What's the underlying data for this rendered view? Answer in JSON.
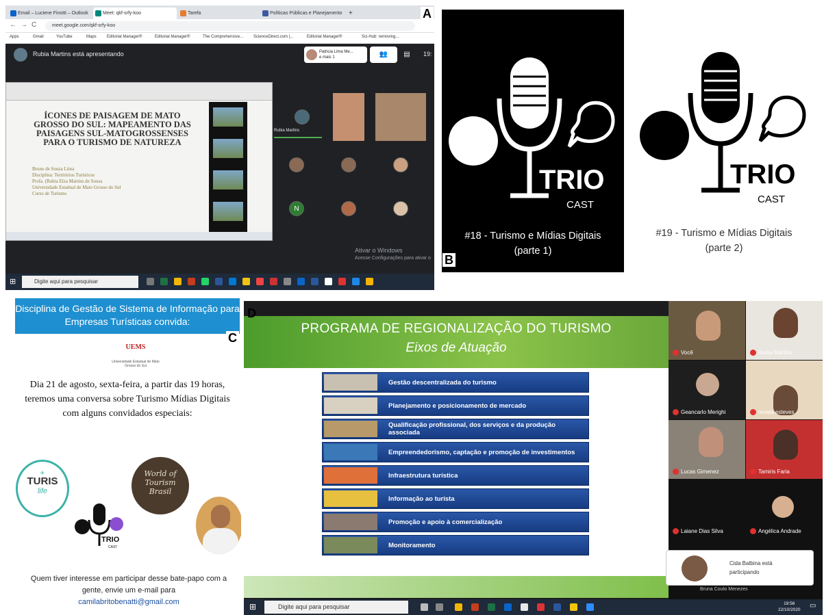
{
  "labels": {
    "a": "A",
    "b": "B",
    "c": "C",
    "d": "D"
  },
  "panelA": {
    "tabs": [
      "Email – Luciene Finotti – Outlook",
      "Meet: qkf-srfy-koo",
      "Tarefa",
      "Políticas Públicas e Planejamento"
    ],
    "url": "meet.google.com/qkf-srfy-koo",
    "bookmarks": [
      "Apps",
      "Gmail",
      "YouTube",
      "Maps",
      "Editorial Manager®",
      "Editorial Manager®",
      "The Comprehensive...",
      "ScienceDirect.com |...",
      "Editorial Manager®",
      "Sci-Hub: removing..."
    ],
    "presenter_text": "Rubia Martins está apresentando",
    "participant_chip": [
      "Patricia Lima Me...",
      "e mais 1"
    ],
    "slide_title": "ÍCONES DE PAISAGEM DE MATO GROSSO DO SUL: MAPEAMENTO DAS PAISAGENS SUL-MATOGROSSENSES PARA O TURISMO DE NATUREZA",
    "slide_lines": [
      "Bruno de Souza Lima",
      "Disciplina: Territórios Turísticos",
      "Profa. (Rubia Elza Martins de Sousa",
      "Universidade Estadual de Mato Grosso do Sul",
      "Curso de Turismo"
    ],
    "self_tile_name": "Rubia Martins",
    "tile_letter": "N",
    "watermark": [
      "Ativar o Windows",
      "Acesse Configurações para ativar o"
    ],
    "taskbar_search": "Digite aqui para pesquisar",
    "clock_fragment": "19:"
  },
  "panelB": {
    "ep1_title": "#18 - Turismo e Mídias Digitais",
    "ep1_part": "(parte 1)",
    "ep2_title": "#19 - Turismo e Mídias Digitais",
    "ep2_part": "(parte 2)",
    "logo_word": "TRIO",
    "logo_sub": "CAST"
  },
  "panelC": {
    "banner": "Disciplina de Gestão de Sistema de Informação para Empresas Turísticas convida:",
    "uems": "UEMS",
    "uems_sub": "Universidade Estadual de Mato Grosso do Sul",
    "invitation": "Dia 21 de agosto, sexta-feira, a partir das 19 horas, teremos uma conversa sobre Turismo Mídias Digitais com alguns convidados especiais:",
    "turis_logo": [
      "TURIS",
      "life"
    ],
    "world_logo": [
      "World of",
      "Tourism",
      "Brasil"
    ],
    "contact": "Quem tiver interesse em participar desse bate-papo com a gente, envie um e-mail para",
    "email": "camilabritobenatti@gmail.com"
  },
  "panelD": {
    "slide_title": "PROGRAMA DE REGIONALIZAÇÃO DO TURISMO",
    "slide_subtitle": "Eixos de Atuação",
    "eixos": [
      "Gestão descentralizada do turismo",
      "Planejamento e posicionamento de mercado",
      "Qualificação profissional, dos serviços e da produção associada",
      "Empreendedorismo, captação e promoção de investimentos",
      "Infraestrutura turística",
      "Informação ao turista",
      "Promoção e apoio à comercialização",
      "Monitoramento"
    ],
    "participants": [
      "Você",
      "Rubia Martins",
      "Geancarlo Merighi",
      "renata esteves",
      "Lucas Gimenez",
      "Tamiris Faria",
      "Laiane Dias Silva",
      "Angélica Andrade"
    ],
    "toast_name": "Cida Balbina está",
    "toast_status": "participando",
    "bottom_name": "Bruna Couto Menezes",
    "taskbar_search": "Digite aqui para pesquisar",
    "time": "19:56",
    "date": "22/10/2020"
  }
}
